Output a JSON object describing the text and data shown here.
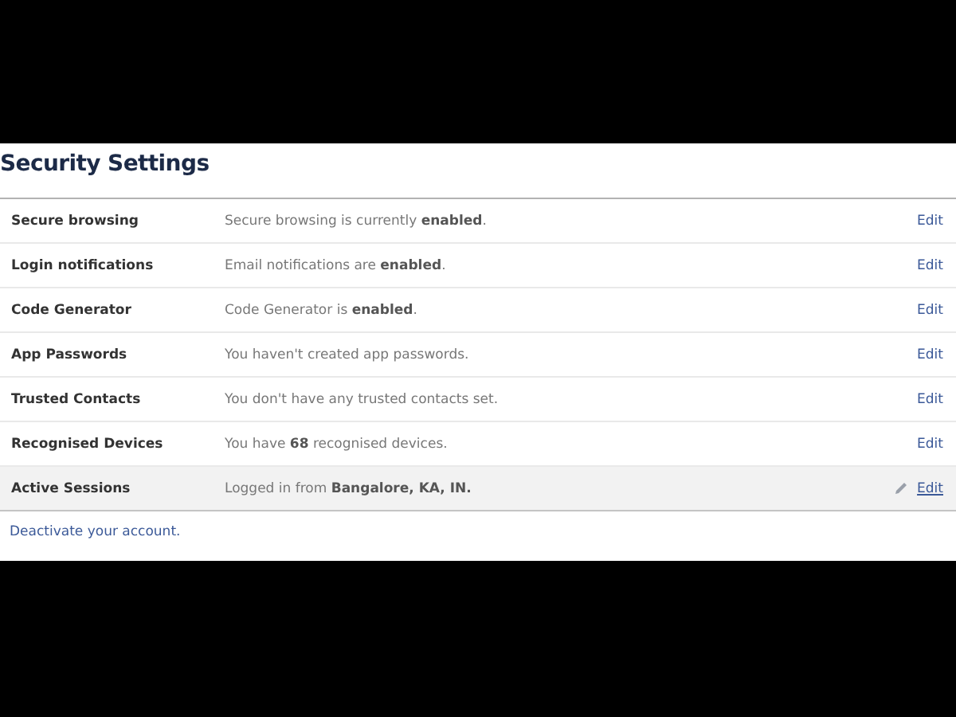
{
  "title": "Security Settings",
  "rows": [
    {
      "label": "Secure browsing",
      "status": "Secure browsing is currently **enabled**.",
      "action": "Edit",
      "hovered": false
    },
    {
      "label": "Login notifications",
      "status": "Email notifications are **enabled**.",
      "action": "Edit",
      "hovered": false
    },
    {
      "label": "Code Generator",
      "status": "Code Generator is **enabled**.",
      "action": "Edit",
      "hovered": false
    },
    {
      "label": "App Passwords",
      "status": "You haven't created app passwords.",
      "action": "Edit",
      "hovered": false
    },
    {
      "label": "Trusted Contacts",
      "status": "You don't have any trusted contacts set.",
      "action": "Edit",
      "hovered": false
    },
    {
      "label": "Recognised Devices",
      "status": "You have **68** recognised devices.",
      "action": "Edit",
      "hovered": false
    },
    {
      "label": "Active Sessions",
      "status": "Logged in from **Bangalore, KA, IN.**",
      "action": "Edit",
      "hovered": true
    }
  ],
  "footer_link": "Deactivate your account."
}
